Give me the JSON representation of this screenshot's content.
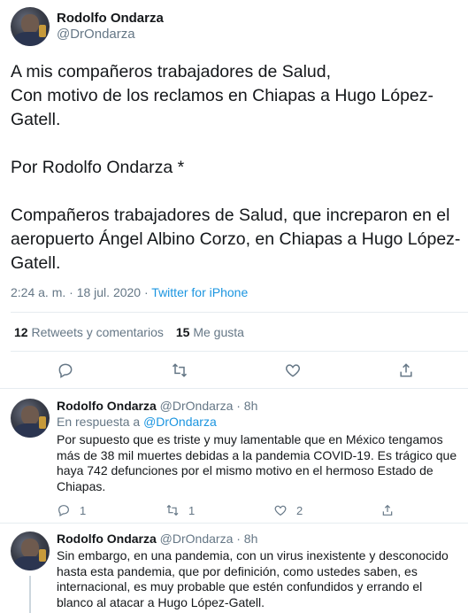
{
  "main_tweet": {
    "author_name": "Rodolfo Ondarza",
    "author_handle": "@DrOndarza",
    "text": "A mis compañeros trabajadores de Salud,\nCon motivo de los reclamos en Chiapas a Hugo López-Gatell.\n\nPor Rodolfo Ondarza *\n\nCompañeros trabajadores de Salud, que increparon en el aeropuerto Ángel Albino Corzo, en Chiapas a Hugo López-Gatell.",
    "timestamp": "2:24 a. m. · 18 jul. 2020",
    "separator": " · ",
    "source": "Twitter for iPhone",
    "retweets_count": "12",
    "retweets_label": "Retweets y comentarios",
    "likes_count": "15",
    "likes_label": "Me gusta"
  },
  "replies": [
    {
      "author_name": "Rodolfo Ondarza",
      "author_handle": "@DrOndarza",
      "time": "· 8h",
      "reply_prefix": "En respuesta a ",
      "reply_to": "@DrOndarza",
      "text": "Por supuesto que es triste y muy lamentable que en México tengamos más de 38 mil muertes debidas a la pandemia COVID-19. Es trágico que haya 742 defunciones por el mismo motivo en el hermoso Estado de Chiapas.",
      "reply_count": "1",
      "retweet_count": "1",
      "like_count": "2"
    },
    {
      "author_name": "Rodolfo Ondarza",
      "author_handle": "@DrOndarza",
      "time": "· 8h",
      "text": "Sin embargo, en una pandemia, con un virus inexistente y desconocido hasta esta pandemia, que por definición, como ustedes saben, es internacional, es muy probable que estén confundidos y errando el blanco al atacar a Hugo López-Gatell."
    }
  ],
  "icons": [
    "reply-icon",
    "retweet-icon",
    "like-icon",
    "share-icon"
  ],
  "colors": {
    "link": "#1b95e0",
    "muted": "#657786",
    "text": "#14171a",
    "border": "#e6ecf0"
  }
}
